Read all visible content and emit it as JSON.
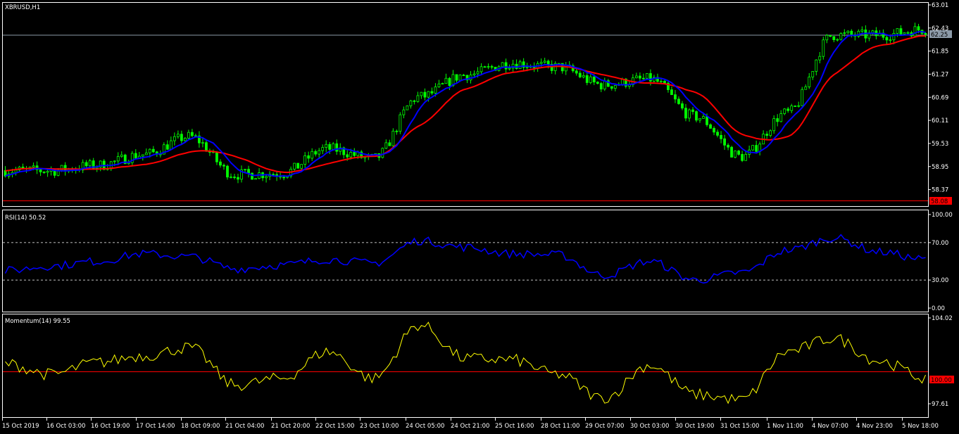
{
  "colors": {
    "background": "#000000",
    "frame": "#ffffff",
    "candle": "#00ff00",
    "ma_fast": "#0000ff",
    "ma_slow": "#ff0000",
    "rsi": "#0000ff",
    "momentum": "#ffff00",
    "level_line": "#ff0000",
    "current_price_line": "#8c9aa8"
  },
  "main": {
    "title": "XBRUSD,H1",
    "bid_price_label": "62.25",
    "low_level_label": "58.08",
    "price_ticks": [
      "63.01",
      "62.43",
      "61.85",
      "61.27",
      "60.69",
      "60.11",
      "59.53",
      "58.95",
      "58.37"
    ]
  },
  "rsi": {
    "title": "RSI(14) 50.52",
    "ticks": [
      "100.00",
      "70.00",
      "30.00",
      "0.00"
    ]
  },
  "momentum": {
    "title": "Momentum(14) 99.55",
    "ticks": [
      "104.02",
      "97.61"
    ],
    "level_label": "100.00"
  },
  "time_labels": [
    "15 Oct 2019",
    "16 Oct 03:00",
    "16 Oct 19:00",
    "17 Oct 14:00",
    "18 Oct 09:00",
    "21 Oct 04:00",
    "21 Oct 20:00",
    "22 Oct 15:00",
    "23 Oct 10:00",
    "24 Oct 05:00",
    "24 Oct 21:00",
    "25 Oct 16:00",
    "28 Oct 11:00",
    "29 Oct 07:00",
    "30 Oct 03:00",
    "30 Oct 19:00",
    "31 Oct 15:00",
    "1 Nov 11:00",
    "4 Nov 07:00",
    "4 Nov 23:00",
    "5 Nov 18:00"
  ],
  "chart_data": [
    {
      "type": "line",
      "title": "XBRUSD,H1",
      "ylim": [
        58.08,
        63.05
      ],
      "x": [
        "15 Oct 2019",
        "16 Oct 03:00",
        "16 Oct 19:00",
        "17 Oct 14:00",
        "18 Oct 09:00",
        "21 Oct 04:00",
        "21 Oct 20:00",
        "22 Oct 15:00",
        "23 Oct 10:00",
        "24 Oct 05:00",
        "24 Oct 21:00",
        "25 Oct 16:00",
        "28 Oct 11:00",
        "29 Oct 07:00",
        "30 Oct 03:00",
        "30 Oct 19:00",
        "31 Oct 15:00",
        "1 Nov 11:00",
        "4 Nov 07:00",
        "4 Nov 23:00",
        "5 Nov 18:00"
      ],
      "series": [
        {
          "values": [
            58.85,
            58.85,
            58.98,
            59.25,
            59.7,
            58.75,
            58.78,
            59.4,
            59.15,
            60.7,
            61.25,
            61.55,
            61.45,
            61.0,
            61.15,
            60.2,
            59.2,
            60.3,
            62.25,
            62.25,
            62.4
          ]
        },
        {
          "values": [
            58.97,
            58.93,
            58.88,
            58.92,
            59.2,
            59.08,
            58.88,
            59.02,
            59.1,
            60.15,
            60.88,
            61.28,
            61.45,
            61.2,
            61.02,
            60.8,
            59.7,
            59.75,
            61.45,
            61.75,
            62.18
          ]
        }
      ]
    },
    {
      "type": "line",
      "title": "RSI(14) 50.52",
      "ylim": [
        0,
        100
      ],
      "x": [
        "15 Oct 2019",
        "16 Oct 03:00",
        "16 Oct 19:00",
        "17 Oct 14:00",
        "18 Oct 09:00",
        "21 Oct 04:00",
        "21 Oct 20:00",
        "22 Oct 15:00",
        "23 Oct 10:00",
        "24 Oct 05:00",
        "24 Oct 21:00",
        "25 Oct 16:00",
        "28 Oct 11:00",
        "29 Oct 07:00",
        "30 Oct 03:00",
        "30 Oct 19:00",
        "31 Oct 15:00",
        "1 Nov 11:00",
        "4 Nov 07:00",
        "4 Nov 23:00",
        "5 Nov 18:00"
      ],
      "values": [
        40,
        45,
        50,
        58,
        55,
        42,
        46,
        52,
        48,
        72,
        65,
        58,
        57,
        35,
        50,
        30,
        38,
        62,
        75,
        60,
        52
      ]
    },
    {
      "type": "line",
      "title": "Momentum(14) 99.55",
      "ylim": [
        97.61,
        104.02
      ],
      "x": [
        "15 Oct 2019",
        "16 Oct 03:00",
        "16 Oct 19:00",
        "17 Oct 14:00",
        "18 Oct 09:00",
        "21 Oct 04:00",
        "21 Oct 20:00",
        "22 Oct 15:00",
        "23 Oct 10:00",
        "24 Oct 05:00",
        "24 Oct 21:00",
        "25 Oct 16:00",
        "28 Oct 11:00",
        "29 Oct 07:00",
        "30 Oct 03:00",
        "30 Oct 19:00",
        "31 Oct 15:00",
        "1 Nov 11:00",
        "4 Nov 07:00",
        "4 Nov 23:00",
        "5 Nov 18:00"
      ],
      "values": [
        100.6,
        99.8,
        100.7,
        101.2,
        101.8,
        99.0,
        99.5,
        101.5,
        99.5,
        103.5,
        101.0,
        100.9,
        99.8,
        98.0,
        100.5,
        98.3,
        97.9,
        101.5,
        102.5,
        100.8,
        99.55
      ]
    }
  ]
}
